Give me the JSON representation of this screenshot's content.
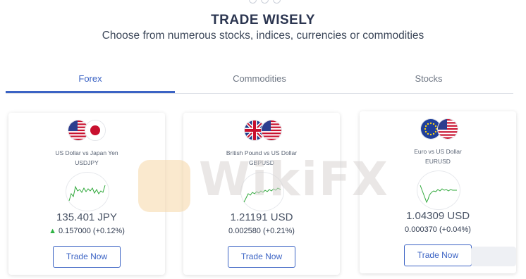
{
  "header": {
    "title": "TRADE WISELY",
    "subtitle": "Choose from numerous stocks, indices, currencies or commodities"
  },
  "tabs": [
    {
      "label": "Forex",
      "active": true
    },
    {
      "label": "Commodities",
      "active": false
    },
    {
      "label": "Stocks",
      "active": false
    }
  ],
  "cards": [
    {
      "name": "US Dollar vs Japan Yen",
      "code": "USDJPY",
      "price": "135.401 JPY",
      "change": "0.157000 (+0.12%)",
      "trend_icon": "arrow-up-icon",
      "button": "Trade Now",
      "flags": [
        "us-flag-icon",
        "japan-flag-icon"
      ]
    },
    {
      "name": "British Pound vs US Dollar",
      "code": "GBPUSD",
      "price": "1.21191 USD",
      "change": "0.002580 (+0.21%)",
      "button": "Trade Now",
      "flags": [
        "uk-flag-icon",
        "us-flag-icon"
      ]
    },
    {
      "name": "Euro vs US Dollar",
      "code": "EURUSD",
      "price": "1.04309 USD",
      "change": "0.000370 (+0.04%)",
      "button": "Trade Now",
      "flags": [
        "eu-flag-icon",
        "us-flag-icon"
      ]
    }
  ],
  "watermark": {
    "text": "WikiFX"
  },
  "colors": {
    "accent": "#3b63c4",
    "sparkline": "#2fa83a",
    "up": "#2fb344"
  }
}
